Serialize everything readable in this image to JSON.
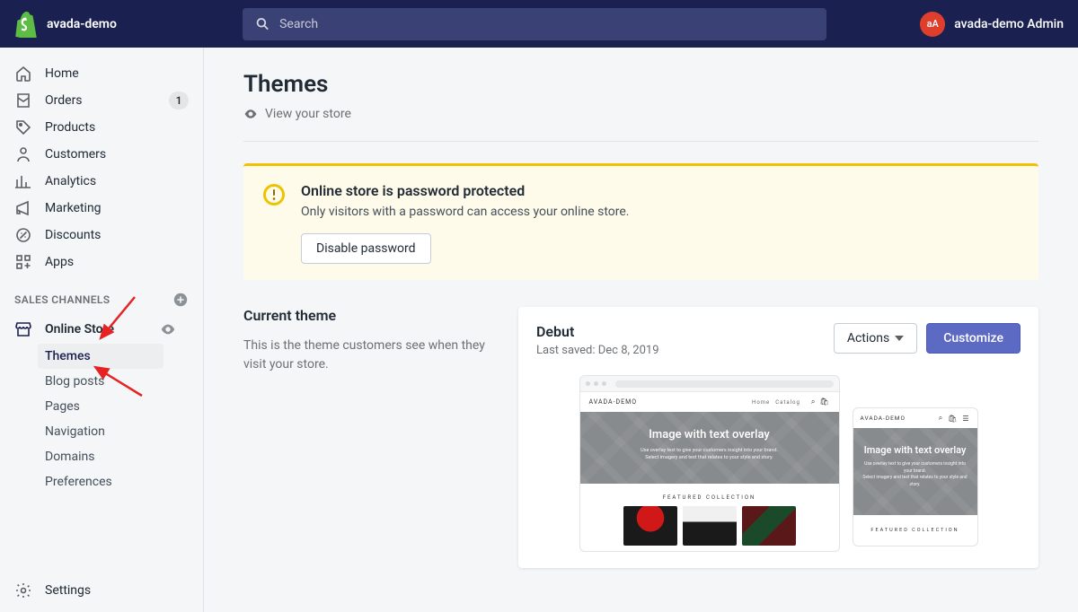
{
  "topbar": {
    "store_name": "avada-demo",
    "search_placeholder": "Search",
    "avatar_initials": "aA",
    "admin_name": "avada-demo Admin"
  },
  "sidebar": {
    "items": [
      {
        "label": "Home"
      },
      {
        "label": "Orders",
        "badge": "1"
      },
      {
        "label": "Products"
      },
      {
        "label": "Customers"
      },
      {
        "label": "Analytics"
      },
      {
        "label": "Marketing"
      },
      {
        "label": "Discounts"
      },
      {
        "label": "Apps"
      }
    ],
    "section_title": "SALES CHANNELS",
    "channel": "Online Store",
    "sub_items": [
      {
        "label": "Themes",
        "active": true
      },
      {
        "label": "Blog posts"
      },
      {
        "label": "Pages"
      },
      {
        "label": "Navigation"
      },
      {
        "label": "Domains"
      },
      {
        "label": "Preferences"
      }
    ],
    "settings": "Settings"
  },
  "page": {
    "title": "Themes",
    "view_store": "View your store"
  },
  "banner": {
    "title": "Online store is password protected",
    "text": "Only visitors with a password can access your online store.",
    "button": "Disable password"
  },
  "current_theme": {
    "heading": "Current theme",
    "description": "This is the theme customers see when they visit your store.",
    "name": "Debut",
    "last_saved": "Last saved: Dec 8, 2019",
    "actions_label": "Actions",
    "customize_label": "Customize"
  },
  "preview": {
    "brand": "AVADA-DEMO",
    "nav_home": "Home",
    "nav_catalog": "Catalog",
    "hero_title": "Image with text overlay",
    "hero_sub1": "Use overlay text to give your customers insight into your brand.",
    "hero_sub2": "Select imagery and text that relates to your style and story.",
    "featured": "FEATURED COLLECTION"
  }
}
